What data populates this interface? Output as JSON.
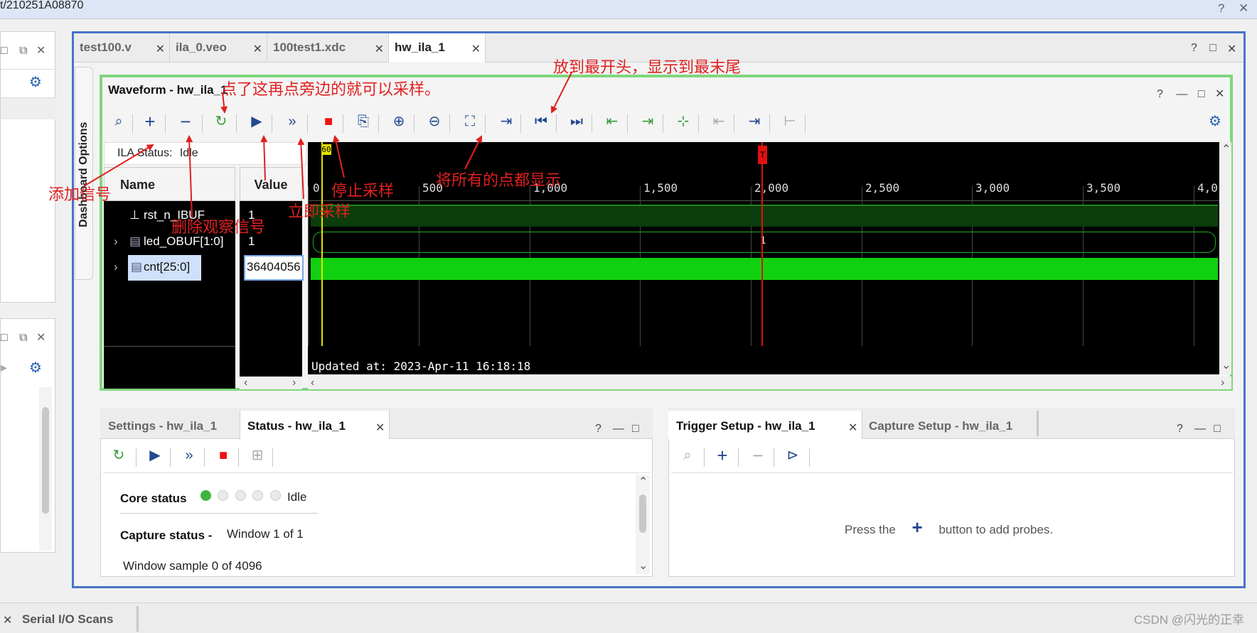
{
  "window": {
    "title": "t/210251A08870",
    "help_glyph": "?",
    "close_glyph": "✕"
  },
  "editor_tabs": [
    {
      "label": "test100.v",
      "active": false
    },
    {
      "label": "ila_0.veo",
      "active": false
    },
    {
      "label": "100test1.xdc",
      "active": false
    },
    {
      "label": "hw_ila_1",
      "active": true
    }
  ],
  "dashboard_options": "Dashboard Options",
  "waveform": {
    "title": "Waveform - hw_ila_1",
    "ila_status_label": "ILA Status:",
    "ila_status_value": "Idle",
    "name_header": "Name",
    "value_header": "Value",
    "signals": [
      {
        "name": "rst_n_IBUF",
        "value": "1"
      },
      {
        "name": "led_OBUF[1:0]",
        "value": "1"
      },
      {
        "name": "cnt[25:0]",
        "value": "36404056"
      }
    ],
    "bus_value": "1",
    "marker_left": "60",
    "trigger_marker": "T",
    "ticks": [
      "0",
      "500",
      "1,000",
      "1,500",
      "2,000",
      "2,500",
      "3,000",
      "3,500",
      "4,0"
    ],
    "updated_at": "Updated at: 2023-Apr-11 16:18:18"
  },
  "bottom_left": {
    "tabs": [
      "Settings - hw_ila_1",
      "Status - hw_ila_1"
    ],
    "core_status_label": "Core status",
    "core_status_value": "Idle",
    "capture_status_label": "Capture status -",
    "capture_status_value": "Window 1 of 1",
    "window_sample": "Window sample 0 of 4096"
  },
  "bottom_right": {
    "tabs": [
      "Trigger Setup - hw_ila_1",
      "Capture Setup - hw_ila_1"
    ],
    "hint_before": "Press the",
    "hint_after": "button to add probes."
  },
  "footer": {
    "tab": "Serial I/O Scans",
    "watermark": "CSDN @闪光的正幸"
  },
  "annotations": {
    "add_signal": "添加信号",
    "remove_signal": "删除观察信号",
    "click_then_side": "点了这再点旁边的就可以采样。",
    "immediate": "立即采样",
    "stop": "停止采样",
    "show_all": "将所有的点都显示",
    "jump_ends": "放到最开头，显示到最末尾"
  },
  "colors": {
    "frame_blue": "#4a73c9",
    "panel_green": "#7fd67f",
    "wave_green": "#0fd10f",
    "annotation_red": "#e02020"
  }
}
